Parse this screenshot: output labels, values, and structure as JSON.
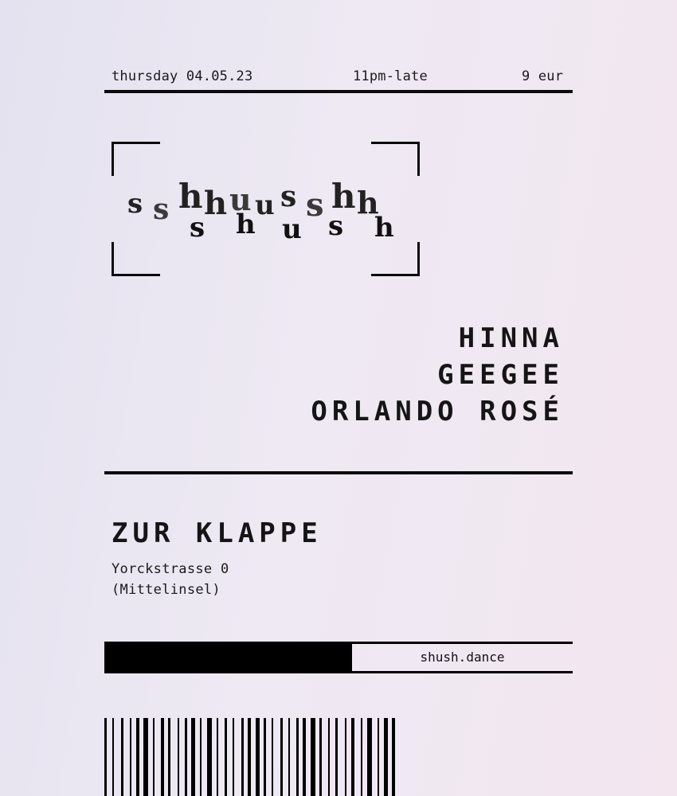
{
  "header": {
    "date": "thursday 04.05.23",
    "time": "11pm-late",
    "price": "9 eur"
  },
  "logo": {
    "line1_letters": [
      "s",
      "s",
      "h",
      "h",
      "u",
      "u",
      "s",
      "s",
      "h",
      "h"
    ],
    "line2_letters": [
      "s",
      "h",
      "u",
      "s",
      "h"
    ]
  },
  "lineup": [
    "HINNA",
    "GEEGEE",
    "ORLANDO ROSÉ"
  ],
  "venue": {
    "name": "ZUR KLAPPE",
    "address_line1": "Yorckstrasse 0",
    "address_line2": "(Mittelinsel)"
  },
  "website": "shush.dance",
  "barcode_widths": [
    3,
    4,
    2,
    6,
    3,
    5,
    2,
    3,
    4,
    2,
    6,
    3,
    2,
    5,
    4,
    2,
    3,
    6,
    2,
    4,
    3,
    2,
    5,
    3,
    2,
    4,
    6,
    3,
    2,
    5,
    3,
    4,
    2,
    6,
    3,
    2,
    4,
    3,
    5,
    2,
    3,
    4,
    2,
    6,
    3,
    4,
    2,
    5,
    3,
    2,
    4,
    3,
    6,
    2,
    3,
    5,
    2,
    4,
    3,
    6,
    2,
    3,
    4,
    5,
    2,
    3,
    6,
    4,
    2,
    3,
    5,
    2,
    4
  ]
}
